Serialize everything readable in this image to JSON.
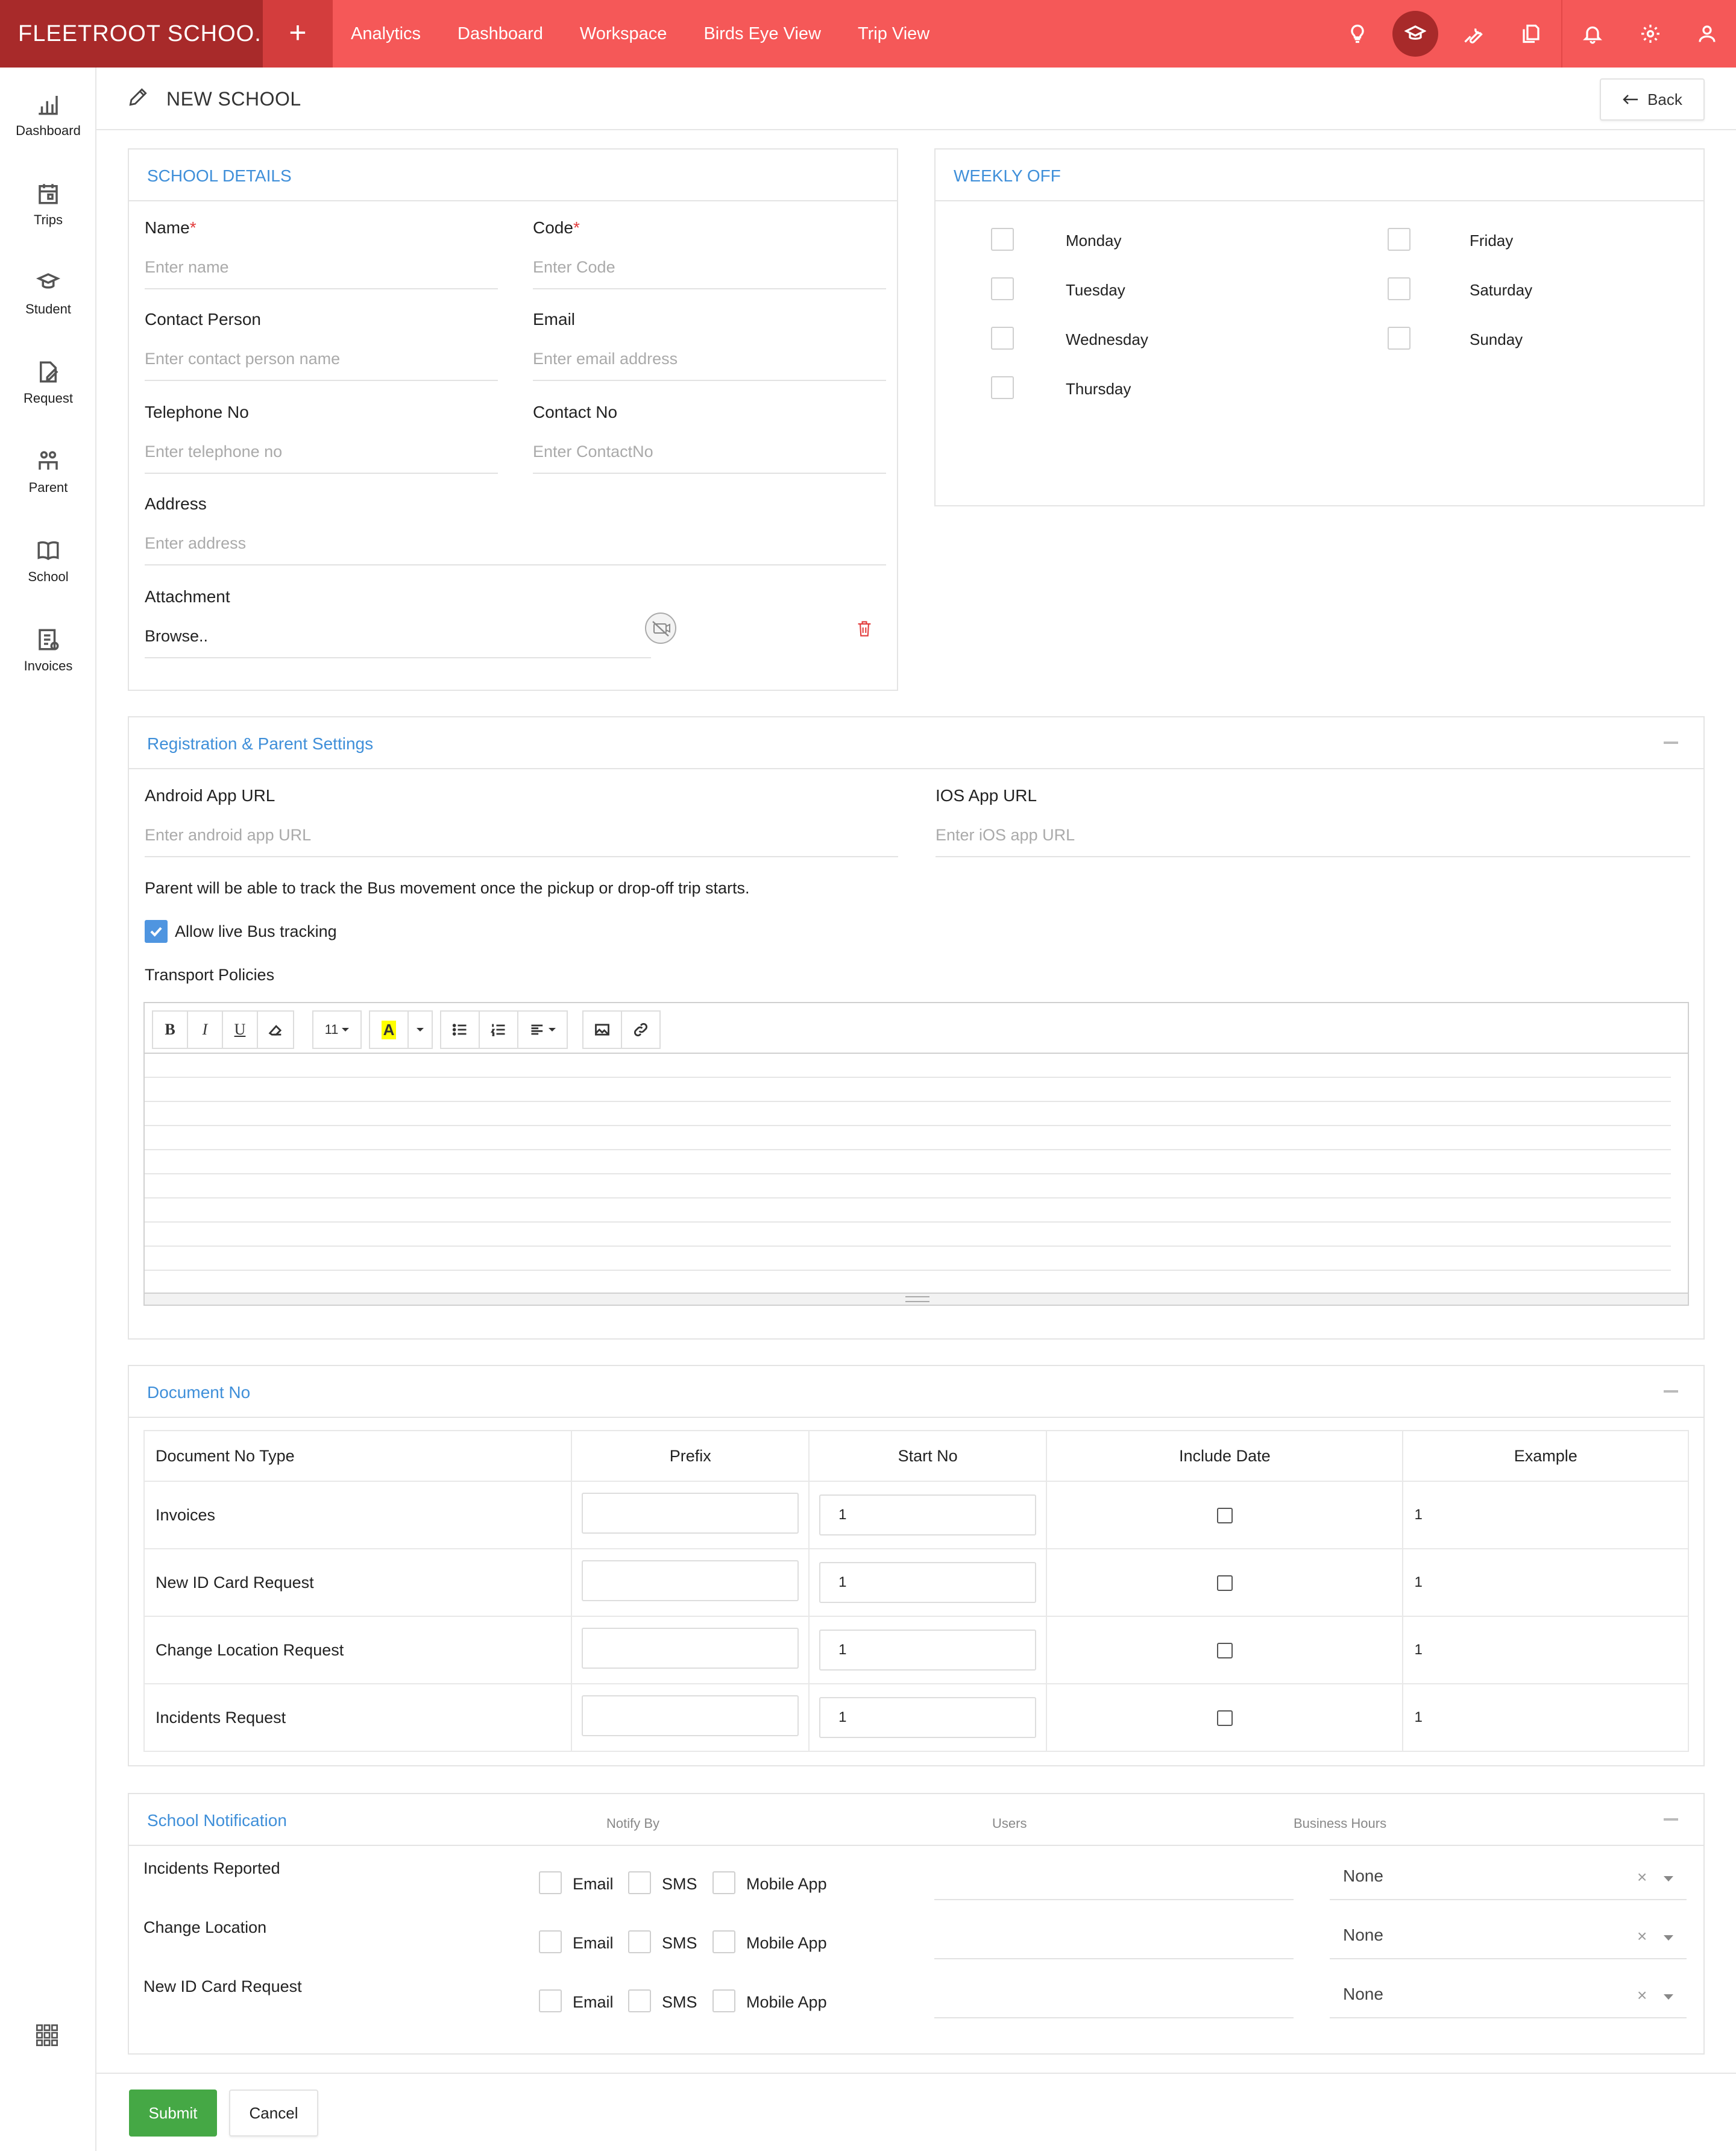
{
  "colors": {
    "topbar": "#f55858",
    "brand_bg": "#a82a2a",
    "accent_blue": "#3f8fd9",
    "submit_green": "#45a845",
    "delete_red": "#e23b3b"
  },
  "topbar": {
    "brand": "FLEETROOT SCHOO...",
    "plus_icon": "plus-icon",
    "nav": [
      "Analytics",
      "Dashboard",
      "Workspace",
      "Birds Eye View",
      "Trip View"
    ],
    "icons": [
      "lightbulb-icon",
      "graduation-cap-icon",
      "wrench-icon",
      "documents-icon",
      "bell-icon",
      "gear-icon",
      "user-icon"
    ]
  },
  "sidebar": {
    "items": [
      {
        "label": "Dashboard",
        "icon": "bar-chart-icon"
      },
      {
        "label": "Trips",
        "icon": "calendar-icon"
      },
      {
        "label": "Student",
        "icon": "student-icon"
      },
      {
        "label": "Request",
        "icon": "request-icon"
      },
      {
        "label": "Parent",
        "icon": "parent-icon"
      },
      {
        "label": "School",
        "icon": "school-book-icon"
      },
      {
        "label": "Invoices",
        "icon": "invoice-icon"
      }
    ],
    "apps_icon": "apps-grid-icon"
  },
  "header": {
    "title": "NEW SCHOOL",
    "back_label": "Back"
  },
  "school_details": {
    "title": "SCHOOL DETAILS",
    "name_label": "Name",
    "name_placeholder": "Enter name",
    "code_label": "Code",
    "code_placeholder": "Enter Code",
    "contact_label": "Contact Person",
    "contact_placeholder": "Enter contact person name",
    "email_label": "Email",
    "email_placeholder": "Enter email address",
    "tel_label": "Telephone No",
    "tel_placeholder": "Enter telephone no",
    "contactno_label": "Contact No",
    "contactno_placeholder": "Enter ContactNo",
    "address_label": "Address",
    "address_placeholder": "Enter address",
    "attachment_label": "Attachment",
    "browse": "Browse..",
    "required_mark": "*"
  },
  "weekly_off": {
    "title": "WEEKLY OFF",
    "days": [
      "Monday",
      "Tuesday",
      "Wednesday",
      "Thursday",
      "Friday",
      "Saturday",
      "Sunday"
    ]
  },
  "registration": {
    "title": "Registration & Parent Settings",
    "android_label": "Android App URL",
    "android_placeholder": "Enter android app URL",
    "ios_label": "IOS App URL",
    "ios_placeholder": "Enter iOS app URL",
    "note": "Parent will be able to track the Bus movement once the pickup or drop-off trip starts.",
    "allow_tracking": "Allow live Bus tracking",
    "allow_tracking_checked": true,
    "policies_label": "Transport Policies",
    "toolbar": {
      "bold": "B",
      "italic": "I",
      "underline": "U",
      "font_size": "11",
      "color": "A"
    }
  },
  "document_no": {
    "title": "Document No",
    "headers": [
      "Document No Type",
      "Prefix",
      "Start No",
      "Include Date",
      "Example"
    ],
    "rows": [
      {
        "type": "Invoices",
        "prefix": "",
        "start": "1",
        "example": "1"
      },
      {
        "type": "New ID Card Request",
        "prefix": "",
        "start": "1",
        "example": "1"
      },
      {
        "type": "Change Location Request",
        "prefix": "",
        "start": "1",
        "example": "1"
      },
      {
        "type": "Incidents Request",
        "prefix": "",
        "start": "1",
        "example": "1"
      }
    ]
  },
  "notification": {
    "title": "School Notification",
    "col_notify": "Notify By",
    "col_users": "Users",
    "col_hours": "Business Hours",
    "rows": [
      {
        "label": "Incidents Reported",
        "email": "Email",
        "sms": "SMS",
        "app": "Mobile App",
        "hours": "None"
      },
      {
        "label": "Change Location",
        "email": "Email",
        "sms": "SMS",
        "app": "Mobile App",
        "hours": "None"
      },
      {
        "label": "New ID Card Request",
        "email": "Email",
        "sms": "SMS",
        "app": "Mobile App",
        "hours": "None"
      }
    ],
    "clear": "×"
  },
  "footer": {
    "submit": "Submit",
    "cancel": "Cancel"
  }
}
